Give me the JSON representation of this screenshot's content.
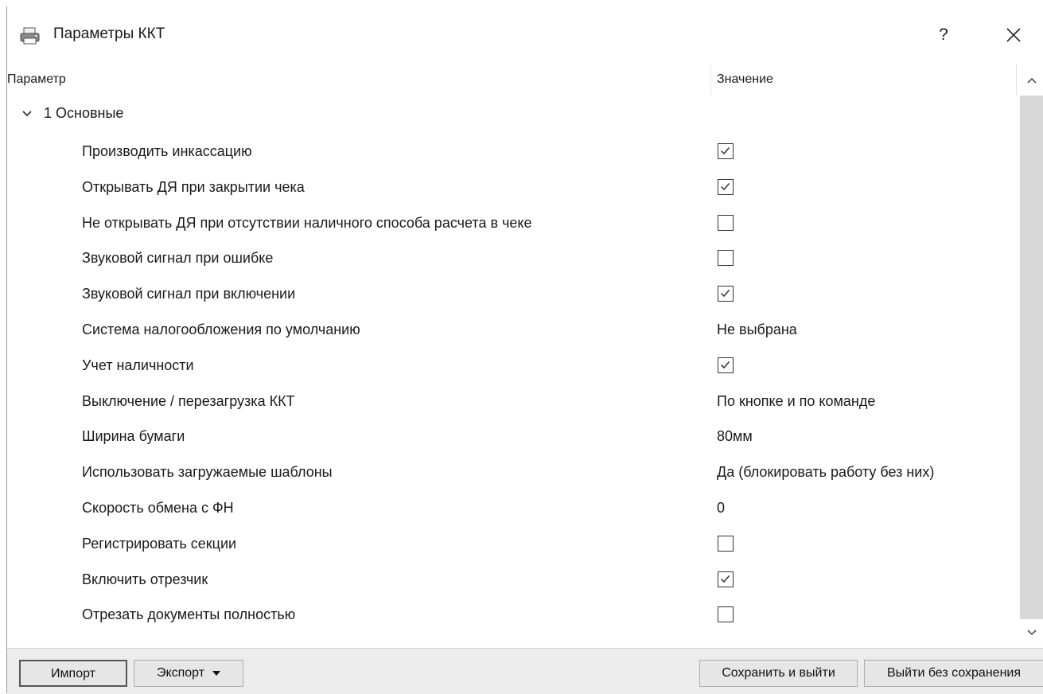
{
  "window": {
    "title": "Параметры ККТ",
    "icon": "printer-icon",
    "help_label": "?",
    "close_icon": "close-icon"
  },
  "tree": {
    "columns": {
      "param": "Параметр",
      "value": "Значение"
    },
    "group": {
      "label": "1 Основные",
      "expanded": true
    },
    "rows": [
      {
        "label": "Производить инкассацию",
        "type": "checkbox",
        "checked": true
      },
      {
        "label": "Открывать ДЯ при закрытии чека",
        "type": "checkbox",
        "checked": true
      },
      {
        "label": "Не открывать ДЯ при отсутствии наличного способа расчета в чеке",
        "type": "checkbox",
        "checked": false
      },
      {
        "label": "Звуковой сигнал при ошибке",
        "type": "checkbox",
        "checked": false
      },
      {
        "label": "Звуковой сигнал при включении",
        "type": "checkbox",
        "checked": true
      },
      {
        "label": "Система налогообложения по умолчанию",
        "type": "text",
        "value": "Не выбрана"
      },
      {
        "label": "Учет наличности",
        "type": "checkbox",
        "checked": true
      },
      {
        "label": "Выключение / перезагрузка ККТ",
        "type": "text",
        "value": "По кнопке и по команде"
      },
      {
        "label": "Ширина бумаги",
        "type": "text",
        "value": "80мм"
      },
      {
        "label": "Использовать загружаемые шаблоны",
        "type": "text",
        "value": "Да (блокировать работу без них)"
      },
      {
        "label": "Скорость обмена с ФН",
        "type": "text",
        "value": "0"
      },
      {
        "label": "Регистрировать секции",
        "type": "checkbox",
        "checked": false
      },
      {
        "label": "Включить отрезчик",
        "type": "checkbox",
        "checked": true
      },
      {
        "label": "Отрезать документы полностью",
        "type": "checkbox",
        "checked": false
      }
    ]
  },
  "buttons": {
    "import": "Импорт",
    "export": "Экспорт",
    "save_exit": "Сохранить и выйти",
    "exit_no_save": "Выйти без сохранения"
  },
  "colors": {
    "thumb": "#d8d8d8",
    "bottom_bar": "#ececec",
    "button_face": "#e6e6e6"
  }
}
